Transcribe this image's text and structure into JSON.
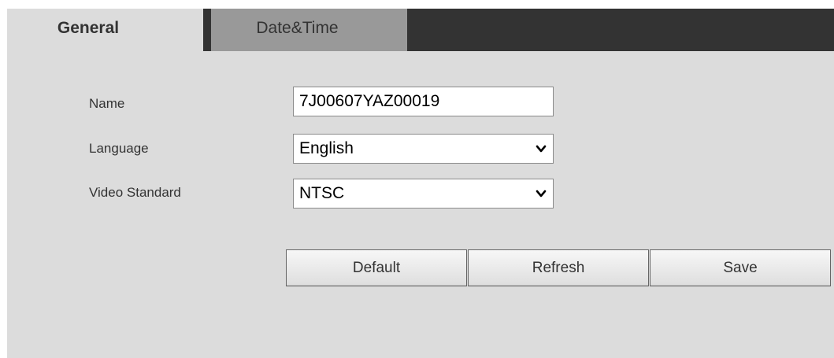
{
  "tabs": [
    {
      "label": "General",
      "active": true
    },
    {
      "label": "Date&Time",
      "active": false
    }
  ],
  "form": {
    "name_label": "Name",
    "name_value": "7J00607YAZ00019",
    "language_label": "Language",
    "language_value": "English",
    "video_standard_label": "Video Standard",
    "video_standard_value": "NTSC"
  },
  "buttons": {
    "default_label": "Default",
    "refresh_label": "Refresh",
    "save_label": "Save"
  },
  "colors": {
    "panel_background": "#dcdcdc",
    "tab_bar": "#333333",
    "inactive_tab": "#999999"
  },
  "icons": {
    "dropdown": "chevron-down-icon"
  }
}
